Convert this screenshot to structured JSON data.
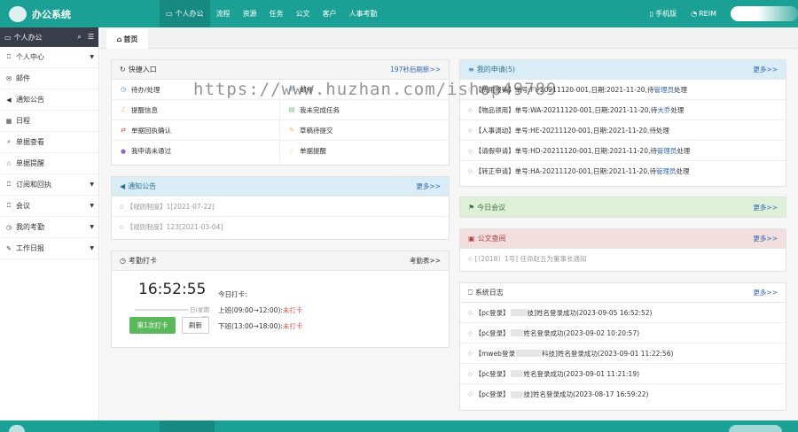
{
  "app": {
    "title": "办公系统"
  },
  "topnav": [
    {
      "icon": "monitor-icon",
      "glyph": "▭",
      "label": "个人办公",
      "active": true
    },
    {
      "label": "流程"
    },
    {
      "label": "资源"
    },
    {
      "label": "任务"
    },
    {
      "label": "公文"
    },
    {
      "label": "客户"
    },
    {
      "label": "人事考勤"
    }
  ],
  "topright": {
    "mobile": "手机版",
    "reim": "REIM"
  },
  "sidebar": {
    "title": "个人办公",
    "items": [
      {
        "label": "个人中心",
        "glyph": "⎕",
        "arrow": true
      },
      {
        "label": "邮件",
        "glyph": "✉",
        "arrow": false
      },
      {
        "label": "通知公告",
        "glyph": "◀",
        "arrow": false
      },
      {
        "label": "日程",
        "glyph": "▦",
        "arrow": false
      },
      {
        "label": "单据查看",
        "glyph": "⌕",
        "arrow": false
      },
      {
        "label": "单据提醒",
        "glyph": "☆",
        "arrow": false
      },
      {
        "label": "订阅和回执",
        "glyph": "⎕",
        "arrow": true
      },
      {
        "label": "会议",
        "glyph": "⎕",
        "arrow": true
      },
      {
        "label": "我的考勤",
        "glyph": "◷",
        "arrow": true
      },
      {
        "label": "工作日报",
        "glyph": "✎",
        "arrow": true
      }
    ]
  },
  "tab": {
    "label": "首页"
  },
  "quick": {
    "title": "快捷入口",
    "more": "197秒后刷新>>",
    "items": [
      {
        "label": "待办/处理",
        "glyph": "◷",
        "color": "#3a87c8"
      },
      {
        "label": "邮件",
        "glyph": "✉",
        "color": "#3a87c8"
      },
      {
        "label": "提醒信息",
        "glyph": "♪",
        "color": "#f0ad4e"
      },
      {
        "label": "我未完成任务",
        "glyph": "▤",
        "color": "#5cb85c"
      },
      {
        "label": "单据回执确认",
        "glyph": "⇄",
        "color": "#d9534f"
      },
      {
        "label": "草稿待提交",
        "glyph": "✎",
        "color": "#f0ad4e"
      },
      {
        "label": "我申请未通过",
        "glyph": "●",
        "color": "#8e6bbf"
      },
      {
        "label": "单据提醒",
        "glyph": "☆",
        "color": "#f0ad4e"
      }
    ]
  },
  "notice": {
    "title": "通知公告",
    "more": "更多>>",
    "items": [
      "【规则制度】1[2021-07-22]",
      "【规则制度】123[2021-03-04]"
    ]
  },
  "attendance": {
    "title": "考勤打卡",
    "more": "考勤表>>",
    "time": "16:52:55",
    "date": "日(星期二)",
    "today": "今日打卡:",
    "am": "上班(09:00→12:00):",
    "pm": "下班(13:00→18:00):",
    "status_am": "未打卡",
    "status_pm": "未打卡",
    "punch": "第1次打卡",
    "refresh": "刷新"
  },
  "apply": {
    "title": "我的申请(5)",
    "more": "更多>>",
    "items": [
      {
        "pre": "【费用报销】单号:FY-20211120-001,日期:2021-11-20,待",
        "hl": "管理员",
        "post": "处理"
      },
      {
        "pre": "【物品领用】单号:WA-20211120-001,日期:2021-11-20,待",
        "hl": "大乔",
        "post": "处理"
      },
      {
        "pre": "【人事调动】单号:HE-20211120-001,日期:2021-11-20,待处理",
        "hl": "",
        "post": ""
      },
      {
        "pre": "【请假申请】单号:HD-20211120-001,日期:2021-11-20,待",
        "hl": "管理员",
        "post": "处理"
      },
      {
        "pre": "【转正申请】单号:HA-20211120-001,日期:2021-11-20,待",
        "hl": "管理员",
        "post": "处理"
      }
    ]
  },
  "meeting": {
    "title": "今日会议",
    "more": "更多>>"
  },
  "doc": {
    "title": "公文查阅",
    "more": "更多>>",
    "items": [
      "[〔2018〕1号] 任命赵五为董事长通知"
    ]
  },
  "log": {
    "title": "系统日志",
    "more": "更多>>",
    "items": [
      {
        "tag": "【pc登录】",
        "tail": "技]姓名登录成功(2023-09-05 16:52:52)"
      },
      {
        "tag": "【pc登录】",
        "tail": "姓名登录成功(2023-09-02 10:20:57)"
      },
      {
        "tag": "【mweb登录",
        "tail": "科技]姓名登录成功(2023-09-01 11:22:56)"
      },
      {
        "tag": "【pc登录】",
        "tail": "姓名登录成功(2023-09-01 11:21:19)"
      },
      {
        "tag": "【pc登录】",
        "tail": "技]姓名登录成功(2023-08-17 16:59:22)"
      }
    ]
  },
  "watermark": "https://www.huzhan.com/ishop49789"
}
